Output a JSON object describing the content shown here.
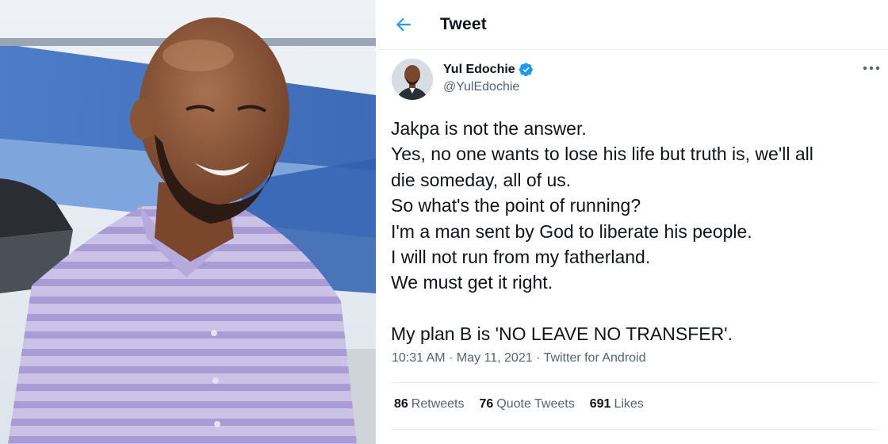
{
  "header": {
    "title": "Tweet",
    "back_icon": "back-arrow-icon"
  },
  "author": {
    "display_name": "Yul Edochie",
    "handle": "@YulEdochie",
    "verified": true,
    "verified_color": "#1d9bf0"
  },
  "tweet": {
    "lines": [
      "Jakpa is not the answer.",
      "Yes, no one wants to lose his life but truth is, we'll all",
      "die someday, all of us.",
      "So what's the point of running?",
      "I'm a man sent by God to liberate his people.",
      "I will not run from my fatherland.",
      "We must get it right.",
      "",
      "My plan B is 'NO LEAVE NO TRANSFER'."
    ],
    "time": "10:31 AM",
    "date": "May 11, 2021",
    "source": "Twitter for Android"
  },
  "stats": {
    "retweets": {
      "count": "86",
      "label": "Retweets"
    },
    "quote_tweets": {
      "count": "76",
      "label": "Quote Tweets"
    },
    "likes": {
      "count": "691",
      "label": "Likes"
    }
  },
  "colors": {
    "accent": "#1d9bf0",
    "text": "#0f1419",
    "muted": "#536471"
  }
}
